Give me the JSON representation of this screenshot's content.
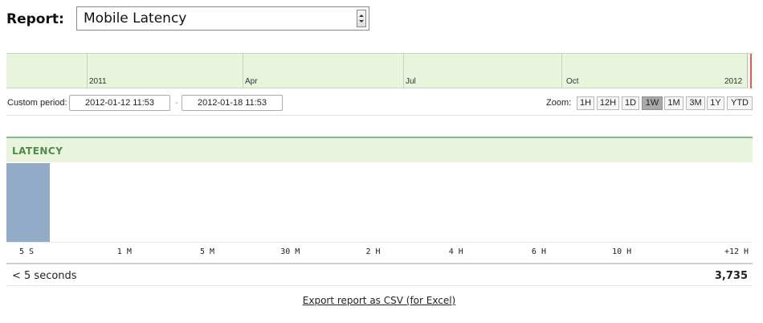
{
  "report": {
    "label": "Report:",
    "selected": "Mobile Latency"
  },
  "timeline": {
    "labels": [
      "2011",
      "Apr",
      "Jul",
      "Oct",
      "2012"
    ]
  },
  "period": {
    "label": "Custom period:",
    "start": "2012-01-12 11:53",
    "separator": "-",
    "end": "2012-01-18 11:53"
  },
  "zoom": {
    "label": "Zoom:",
    "buttons": [
      "1H",
      "12H",
      "1D",
      "1W",
      "1M",
      "3M",
      "1Y",
      "YTD"
    ],
    "active": "1W"
  },
  "latency": {
    "title": "LATENCY",
    "summary_label": "< 5 seconds",
    "summary_value": "3,735",
    "bar_color": "#92abc6",
    "header_color": "#e8f4dc"
  },
  "chart_data": {
    "type": "bar",
    "categories": [
      "5 S",
      "1 M",
      "5 M",
      "30 M",
      "2 H",
      "4 H",
      "6 H",
      "10 H",
      "+12 H"
    ],
    "values": [
      3735,
      0,
      0,
      0,
      0,
      0,
      0,
      0,
      0
    ]
  },
  "export": {
    "label": "Export report as CSV (for Excel)"
  }
}
